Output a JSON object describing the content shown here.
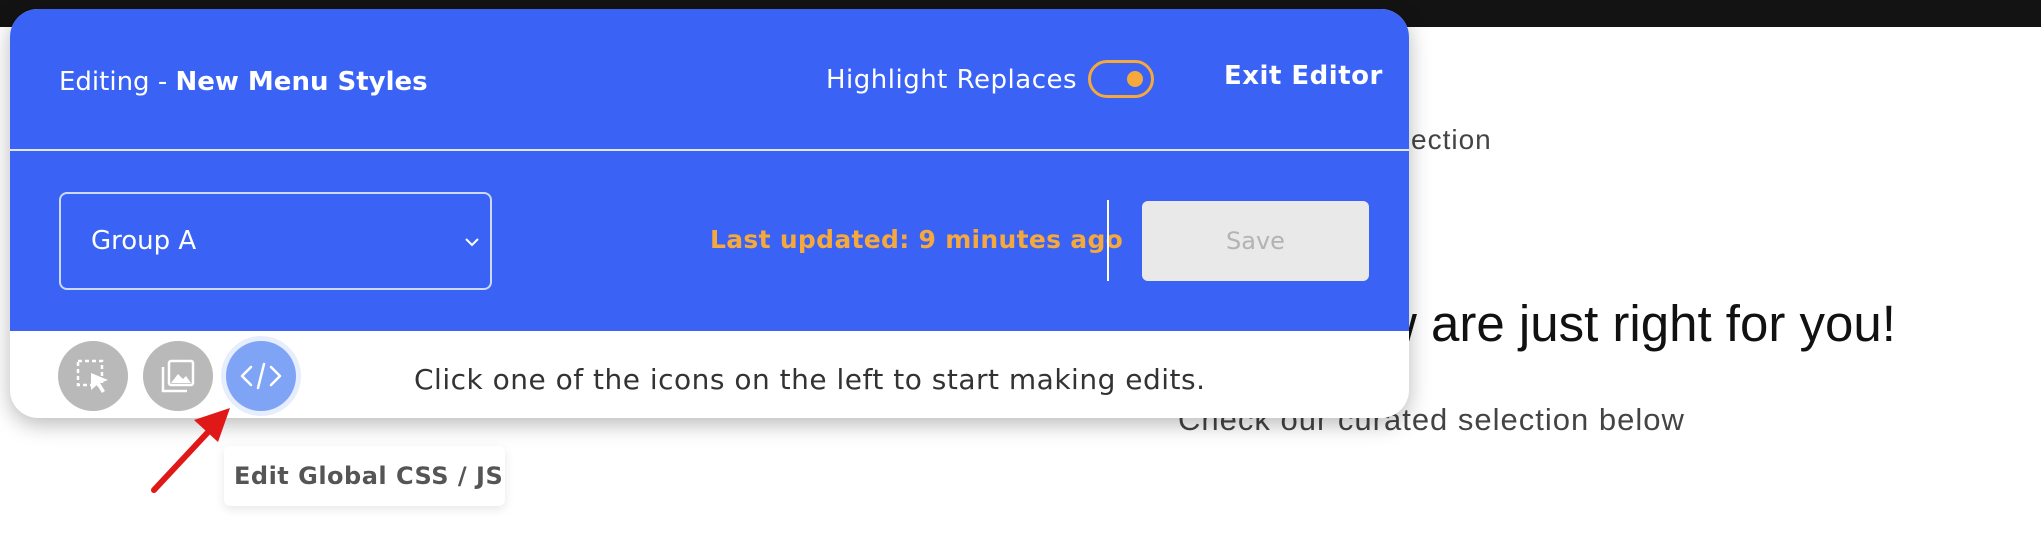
{
  "background": {
    "collection_text": "ollection",
    "headline": "w are just right for you!",
    "subtext": "Check our curated selection below"
  },
  "editor": {
    "title_prefix": "Editing - ",
    "title_name": "New Menu Styles",
    "highlight_label": "Highlight Replaces",
    "highlight_on": true,
    "exit_label": "Exit Editor",
    "group_select_value": "Group A",
    "last_updated": "Last updated: 9 minutes ago",
    "save_label": "Save",
    "instruction": "Click one of the icons on the left to start making edits.",
    "tools": [
      {
        "name": "select-element-icon"
      },
      {
        "name": "image-icon"
      },
      {
        "name": "code-icon",
        "active": true
      }
    ],
    "tooltip": "Edit Global CSS / JS"
  },
  "colors": {
    "editor_blue": "#3a63f5",
    "accent_orange": "#f5a83c",
    "active_tool": "#7fa3f5",
    "arrow_red": "#e01818"
  }
}
